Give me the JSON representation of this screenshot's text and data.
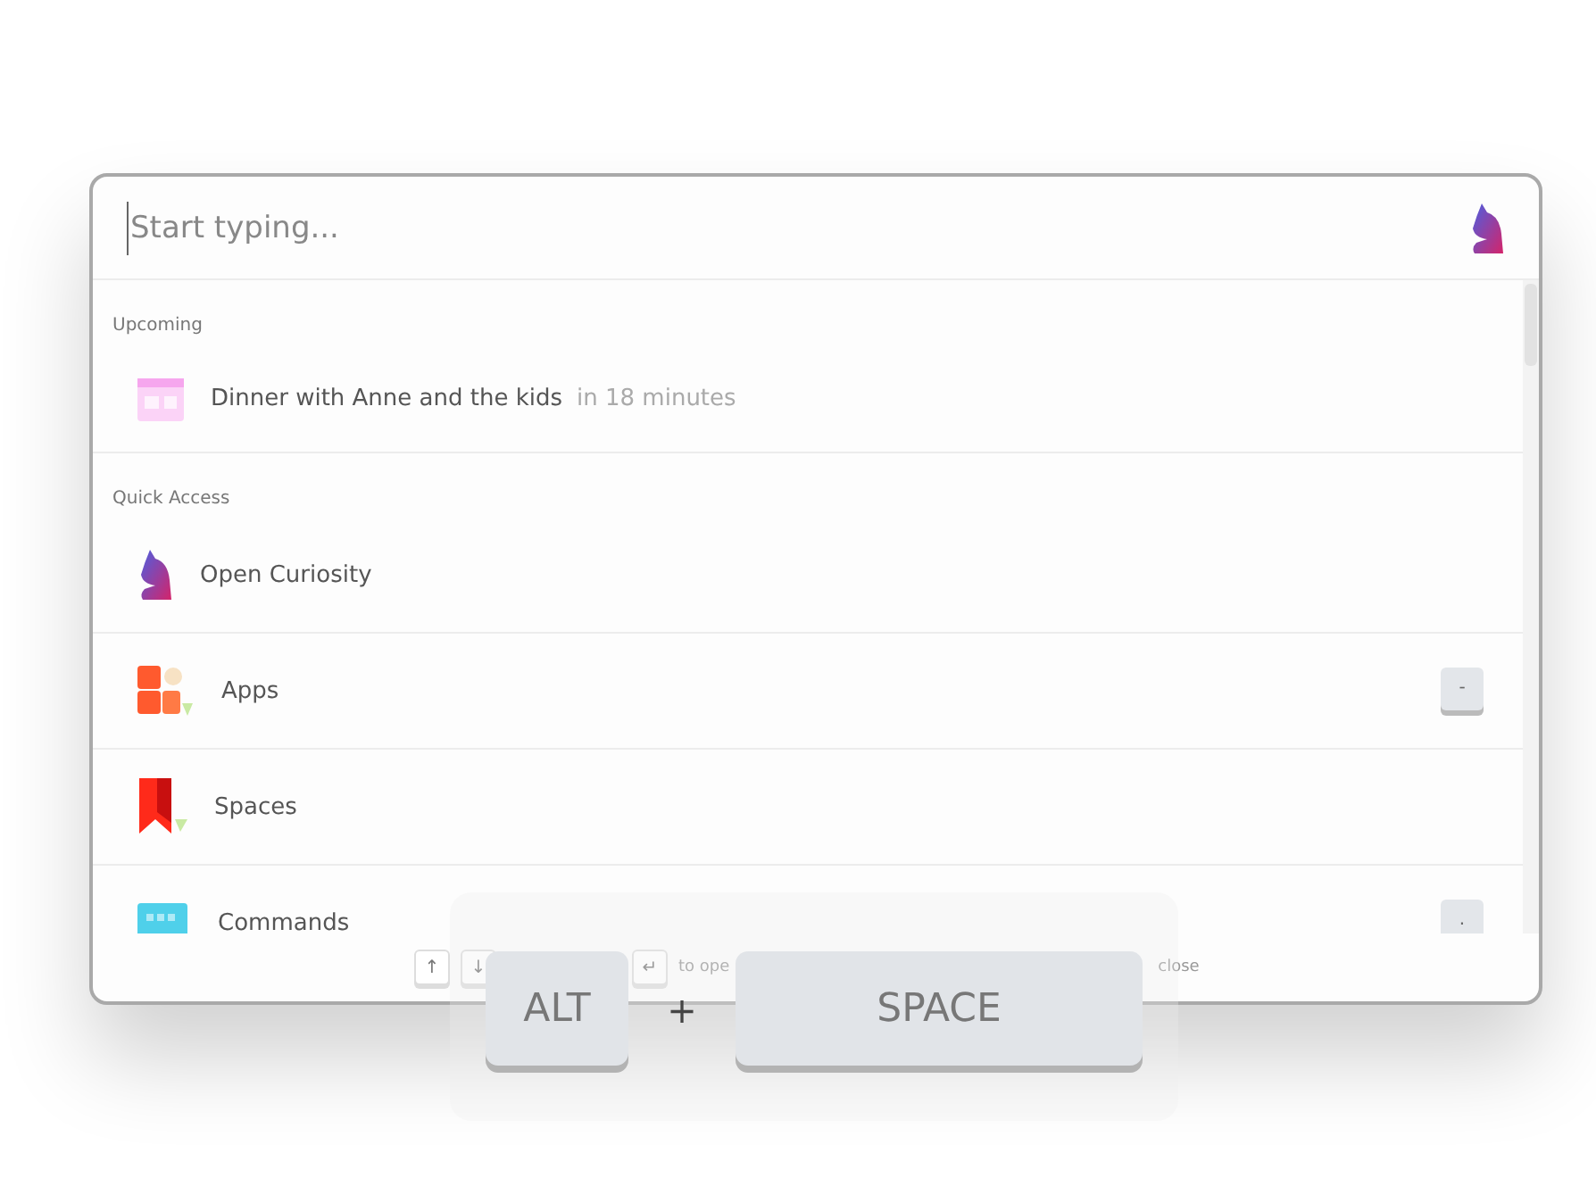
{
  "search": {
    "placeholder": "Start typing..."
  },
  "sections": [
    {
      "title": "Upcoming",
      "items": [
        {
          "kind": "event",
          "label": "Dinner with Anne and the kids",
          "note": "in 18 minutes"
        }
      ]
    },
    {
      "title": "Quick Access",
      "items": [
        {
          "kind": "curiosity",
          "label": "Open Curiosity"
        },
        {
          "kind": "apps",
          "label": "Apps",
          "shortcut": "-"
        },
        {
          "kind": "spaces",
          "label": "Spaces"
        },
        {
          "kind": "commands",
          "label": "Commands",
          "shortcut": "."
        }
      ]
    }
  ],
  "footer": {
    "keys_left": [
      "↑",
      "↓"
    ],
    "enter_key": "↵",
    "open_hint": "to ope",
    "close_hint": "close"
  },
  "hotkey": {
    "keys": [
      "ALT",
      "SPACE"
    ],
    "joiner": "+"
  }
}
